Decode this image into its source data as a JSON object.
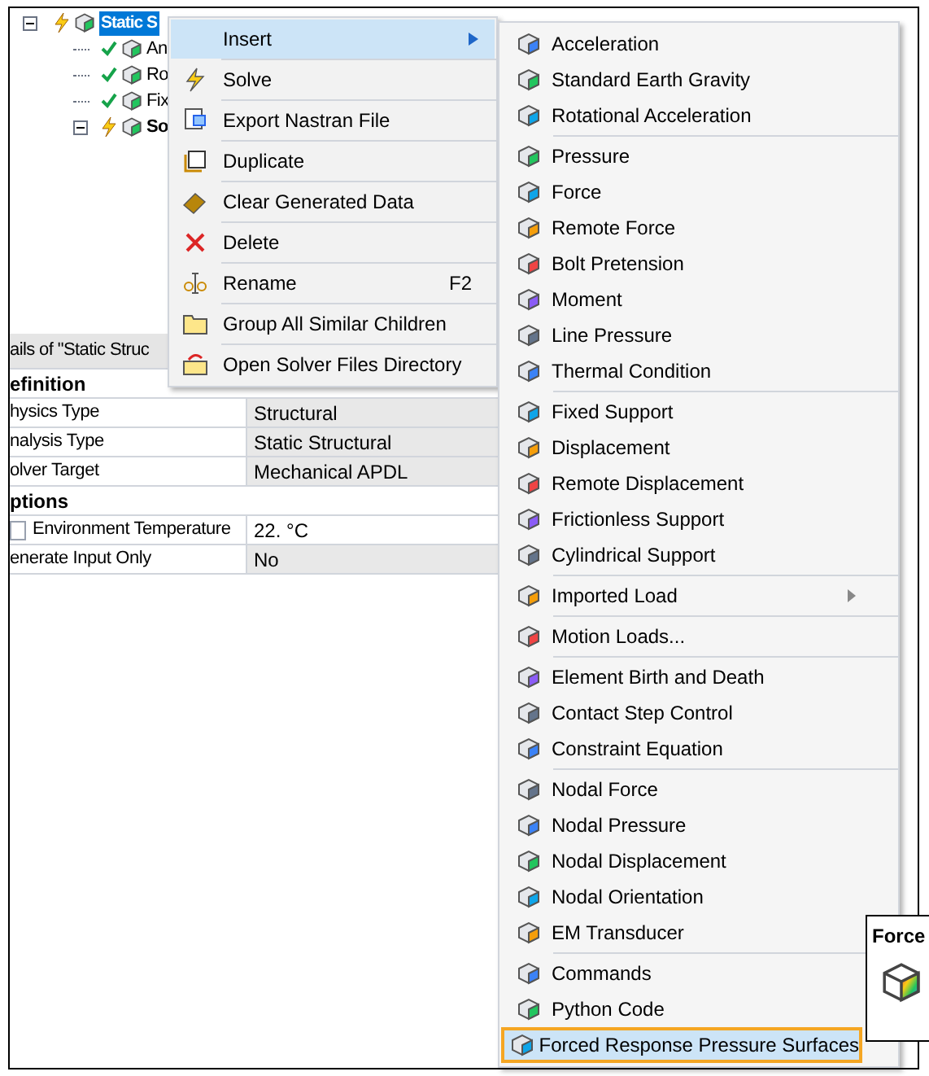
{
  "tree": [
    {
      "label": "Static S",
      "solved": false,
      "expanded": true,
      "selected": true,
      "children": [
        {
          "label": "An",
          "solved": true,
          "selected": false
        },
        {
          "label": "Ro",
          "solved": true,
          "selected": false
        },
        {
          "label": "Fix",
          "solved": true,
          "selected": false
        },
        {
          "label": "So",
          "solved": false,
          "expanded": true,
          "selected": false,
          "bold": true
        }
      ]
    }
  ],
  "details": {
    "title": "ails of \"Static Struc",
    "rows": [
      {
        "kind": "group",
        "label": "efinition"
      },
      {
        "kind": "property",
        "label": "hysics Type",
        "value": "Structural",
        "read_only": true
      },
      {
        "kind": "property",
        "label": "nalysis Type",
        "value": "Static Structural",
        "read_only": true
      },
      {
        "kind": "property",
        "label": "olver Target",
        "value": "Mechanical APDL",
        "read_only": true
      },
      {
        "kind": "group",
        "label": "ptions"
      },
      {
        "kind": "property",
        "label": "Environment Temperature",
        "value": "22. °C",
        "read_only": false,
        "checked": false
      },
      {
        "kind": "property",
        "label": "enerate Input Only",
        "value": "No",
        "read_only": true
      }
    ]
  },
  "context_menu": [
    {
      "label": "Insert",
      "selected": true,
      "has_submenu": true
    },
    {
      "label": "Solve",
      "selected": false
    },
    {
      "label": "Export Nastran File",
      "selected": false
    },
    {
      "label": "Duplicate",
      "selected": false
    },
    {
      "label": "Clear Generated Data",
      "selected": false
    },
    {
      "label": "Delete",
      "selected": false
    },
    {
      "label": "Rename",
      "selected": false,
      "shortcut": "F2"
    },
    {
      "label": "Group All Similar Children",
      "selected": false
    },
    {
      "label": "Open Solver Files Directory",
      "selected": false
    }
  ],
  "submenu": [
    [
      {
        "label": "Acceleration",
        "selected": false
      },
      {
        "label": "Standard Earth Gravity",
        "selected": false
      },
      {
        "label": "Rotational Acceleration",
        "selected": false
      }
    ],
    [
      {
        "label": "Pressure",
        "selected": false
      },
      {
        "label": "Force",
        "selected": false
      },
      {
        "label": "Remote Force",
        "selected": false
      },
      {
        "label": "Bolt Pretension",
        "selected": false
      },
      {
        "label": "Moment",
        "selected": false
      },
      {
        "label": "Line Pressure",
        "selected": false
      },
      {
        "label": "Thermal Condition",
        "selected": false
      }
    ],
    [
      {
        "label": "Fixed Support",
        "selected": false
      },
      {
        "label": "Displacement",
        "selected": false
      },
      {
        "label": "Remote Displacement",
        "selected": false
      },
      {
        "label": "Frictionless Support",
        "selected": false
      },
      {
        "label": "Cylindrical Support",
        "selected": false
      }
    ],
    [
      {
        "label": "Imported Load",
        "selected": false,
        "has_submenu": true
      }
    ],
    [
      {
        "label": "Motion Loads...",
        "selected": false
      }
    ],
    [
      {
        "label": "Element Birth and Death",
        "selected": false
      },
      {
        "label": "Contact Step Control",
        "selected": false
      },
      {
        "label": "Constraint Equation",
        "selected": false
      }
    ],
    [
      {
        "label": "Nodal Force",
        "selected": false
      },
      {
        "label": "Nodal Pressure",
        "selected": false
      },
      {
        "label": "Nodal Displacement",
        "selected": false
      },
      {
        "label": "Nodal Orientation",
        "selected": false
      },
      {
        "label": "EM Transducer",
        "selected": false
      }
    ],
    [
      {
        "label": "Commands",
        "selected": false
      },
      {
        "label": "Python Code",
        "selected": false
      },
      {
        "label": "Forced Response Pressure Surfaces",
        "selected": true
      }
    ]
  ],
  "tooltip": {
    "title": "Force"
  }
}
